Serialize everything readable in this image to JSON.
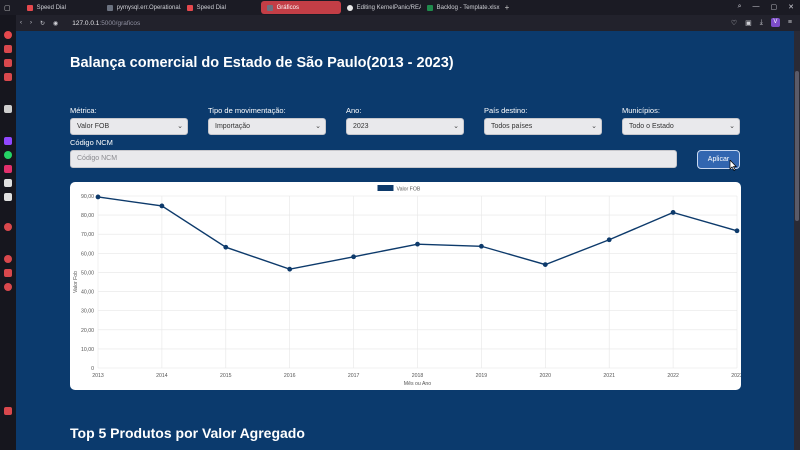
{
  "browser": {
    "tabs": [
      {
        "label": "Speed Dial",
        "active": false,
        "icon": "speed-dial-icon"
      },
      {
        "label": "pymysql.err.Operational...",
        "active": false,
        "icon": "page-icon"
      },
      {
        "label": "Speed Dial",
        "active": false,
        "icon": "speed-dial-icon"
      },
      {
        "label": "Gráficos",
        "active": true,
        "icon": "page-icon"
      },
      {
        "label": "Editing KernelPanic/REA...",
        "active": false,
        "icon": "github-icon"
      },
      {
        "label": "Backlog - Template.xlsx",
        "active": false,
        "icon": "excel-icon"
      }
    ],
    "url_host": "127.0.0.1",
    "url_path": ":5000/graficos",
    "avatar_letter": "V"
  },
  "page": {
    "title": "Balança comercial do Estado de São Paulo(2013 - 2023)",
    "filters": {
      "metric_label": "Métrica:",
      "metric_value": "Valor FOB",
      "movement_label": "Tipo de movimentação:",
      "movement_value": "Importação",
      "year_label": "Ano:",
      "year_value": "2023",
      "country_label": "País destino:",
      "country_value": "Todos países",
      "city_label": "Municípios:",
      "city_value": "Todo o Estado",
      "ncm_label": "Código NCM",
      "ncm_placeholder": "Código NCM",
      "apply_label": "Aplicar"
    },
    "next_section_title": "Top 5 Produtos por Valor Agregado"
  },
  "chart_data": {
    "type": "line",
    "x": [
      "2013",
      "2014",
      "2015",
      "2016",
      "2017",
      "2018",
      "2019",
      "2020",
      "2021",
      "2022",
      "2023"
    ],
    "series": [
      {
        "name": "Valor FOB",
        "values": [
          89.5,
          84.8,
          63.2,
          51.7,
          58.2,
          64.8,
          63.7,
          54.1,
          67.1,
          81.4,
          71.8
        ],
        "color": "#0d3a6b"
      }
    ],
    "ylim": [
      0,
      90
    ],
    "yticks": [
      "0",
      "10,00",
      "20,00",
      "30,00",
      "40,00",
      "50,00",
      "60,00",
      "70,00",
      "80,00",
      "90,00"
    ],
    "xlabel": "Mês ou Ano",
    "ylabel": "Valor Fob",
    "legend": "top-center",
    "grid": true
  }
}
